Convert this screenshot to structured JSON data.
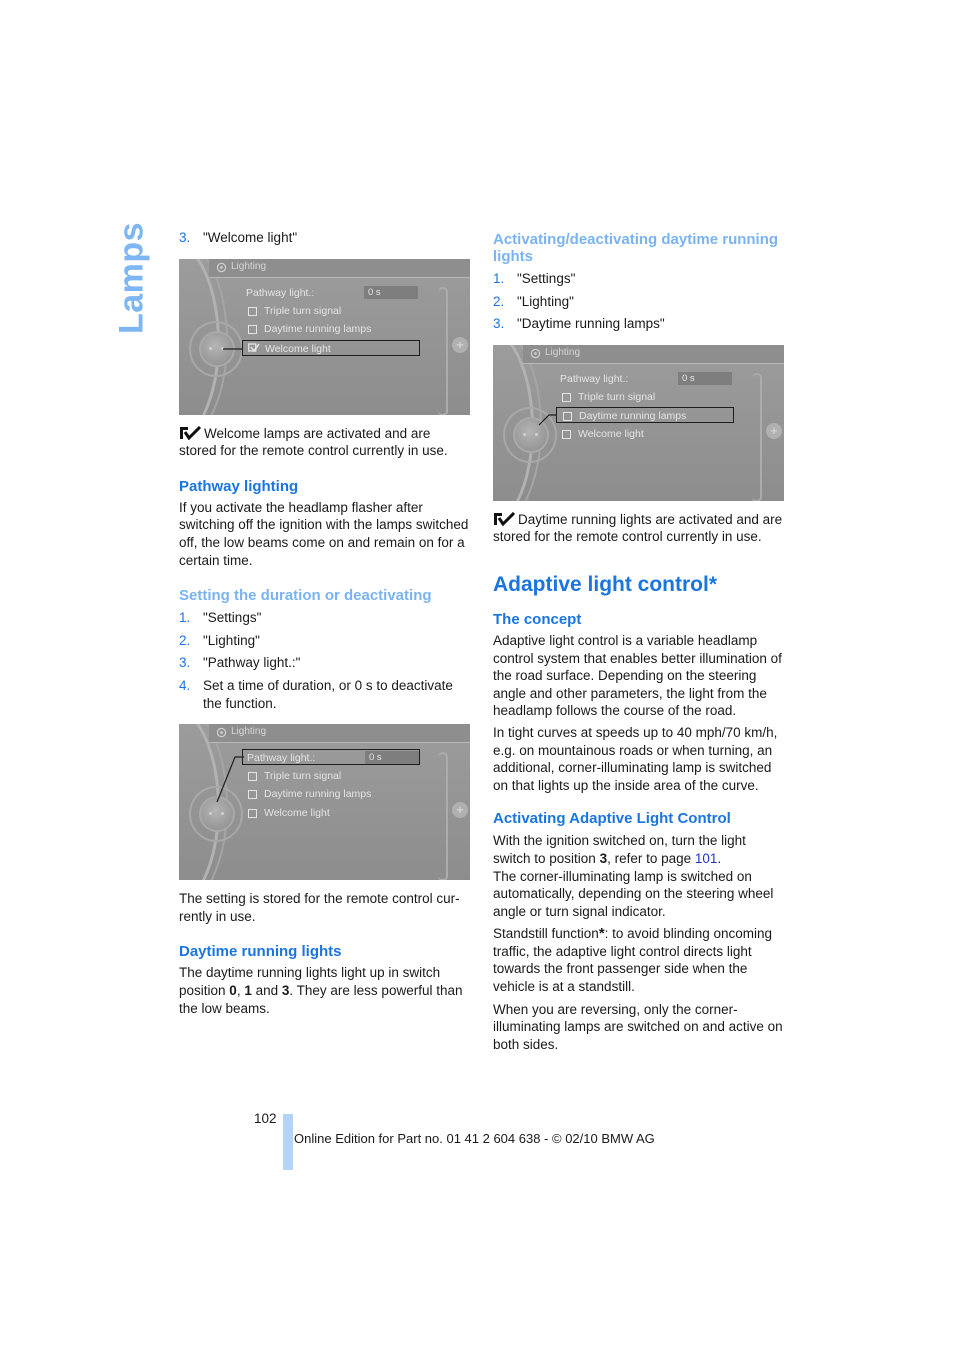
{
  "side_tab": "Lamps",
  "left": {
    "step3": {
      "num": "3.",
      "text": "\"Welcome light\""
    },
    "screen1": {
      "title": "Lighting",
      "pathway_label": "Pathway light.:",
      "pathway_value": "0 s",
      "items": [
        "Triple turn signal",
        "Daytime running lamps",
        "Welcome light"
      ],
      "checked": "Welcome light",
      "selected": "Welcome light"
    },
    "note1": "Welcome lamps are activated and are stored for the remote control currently in use.",
    "pathway_heading": "Pathway lighting",
    "pathway_text": "If you activate the headlamp flasher after switching off the ignition with the lamps switched off, the low beams come on and remain on for a certain time.",
    "duration_heading": "Setting the duration or deactivating",
    "duration_steps": [
      {
        "num": "1.",
        "text": "\"Settings\""
      },
      {
        "num": "2.",
        "text": "\"Lighting\""
      },
      {
        "num": "3.",
        "text": "\"Pathway light.:\""
      },
      {
        "num": "4.",
        "text": "Set a time of duration, or 0 s to deactivate the function."
      }
    ],
    "screen2": {
      "title": "Lighting",
      "pathway_label": "Pathway light.:",
      "pathway_value": "0 s",
      "items": [
        "Triple turn signal",
        "Daytime running lamps",
        "Welcome light"
      ],
      "selected": "Pathway light.:"
    },
    "stored_text": "The setting is stored for the remote control cur-rently in use.",
    "drl_heading": "Daytime running lights",
    "drl_text_1": "The daytime running lights light up in switch position ",
    "drl_b0": "0",
    "drl_sep1": ", ",
    "drl_b1": "1",
    "drl_sep2": " and ",
    "drl_b3": "3",
    "drl_text_2": ". They are less powerful than the low beams."
  },
  "right": {
    "act_heading": "Activating/deactivating daytime running lights",
    "act_steps": [
      {
        "num": "1.",
        "text": "\"Settings\""
      },
      {
        "num": "2.",
        "text": "\"Lighting\""
      },
      {
        "num": "3.",
        "text": "\"Daytime running lamps\""
      }
    ],
    "screen3": {
      "title": "Lighting",
      "pathway_label": "Pathway light.:",
      "pathway_value": "0 s",
      "items": [
        "Triple turn signal",
        "Daytime running lamps",
        "Welcome light"
      ],
      "selected": "Daytime running lamps"
    },
    "note2": "Daytime running lights are activated and are stored for the remote control currently in use.",
    "alc_heading": "Adaptive light control*",
    "concept_heading": "The concept",
    "concept_p1": "Adaptive light control is a variable headlamp control system that enables better illumination of the road surface. Depending on the steering angle and other parameters, the light from the headlamp follows the course of the road.",
    "concept_p2": "In tight curves at speeds up to 40 mph/70 km/h, e.g. on mountainous roads or when turning, an additional, corner-illuminating lamp is switched on that lights up the inside area of the curve.",
    "activating_heading": "Activating Adaptive Light Control",
    "activating_p1a": "With the ignition switched on, turn the light switch to position ",
    "activating_p1_bold": "3",
    "activating_p1b": ", refer to page ",
    "activating_link": "101",
    "activating_p1c": ".",
    "activating_p2": "The corner-illuminating lamp is switched on automatically, depending on the steering wheel angle or turn signal indicator.",
    "standstill_a": "Standstill function",
    "standstill_star": "*",
    "standstill_b": ": to avoid blinding oncoming traffic, the adaptive light control directs light towards the front passenger side when the vehicle is at a standstill.",
    "reversing": "When you are reversing, only the corner-illuminating lamps are switched on and active on both sides."
  },
  "footer": {
    "page_number": "102",
    "edition": "Online Edition for Part no. 01 41 2 604 638 - © 02/10 BMW AG"
  },
  "colors": {
    "heading_blue": "#1a75e0",
    "light_blue": "#7ab3f2",
    "tab_blue": "#7eb6f4",
    "footer_bar": "#b3d4f7"
  }
}
